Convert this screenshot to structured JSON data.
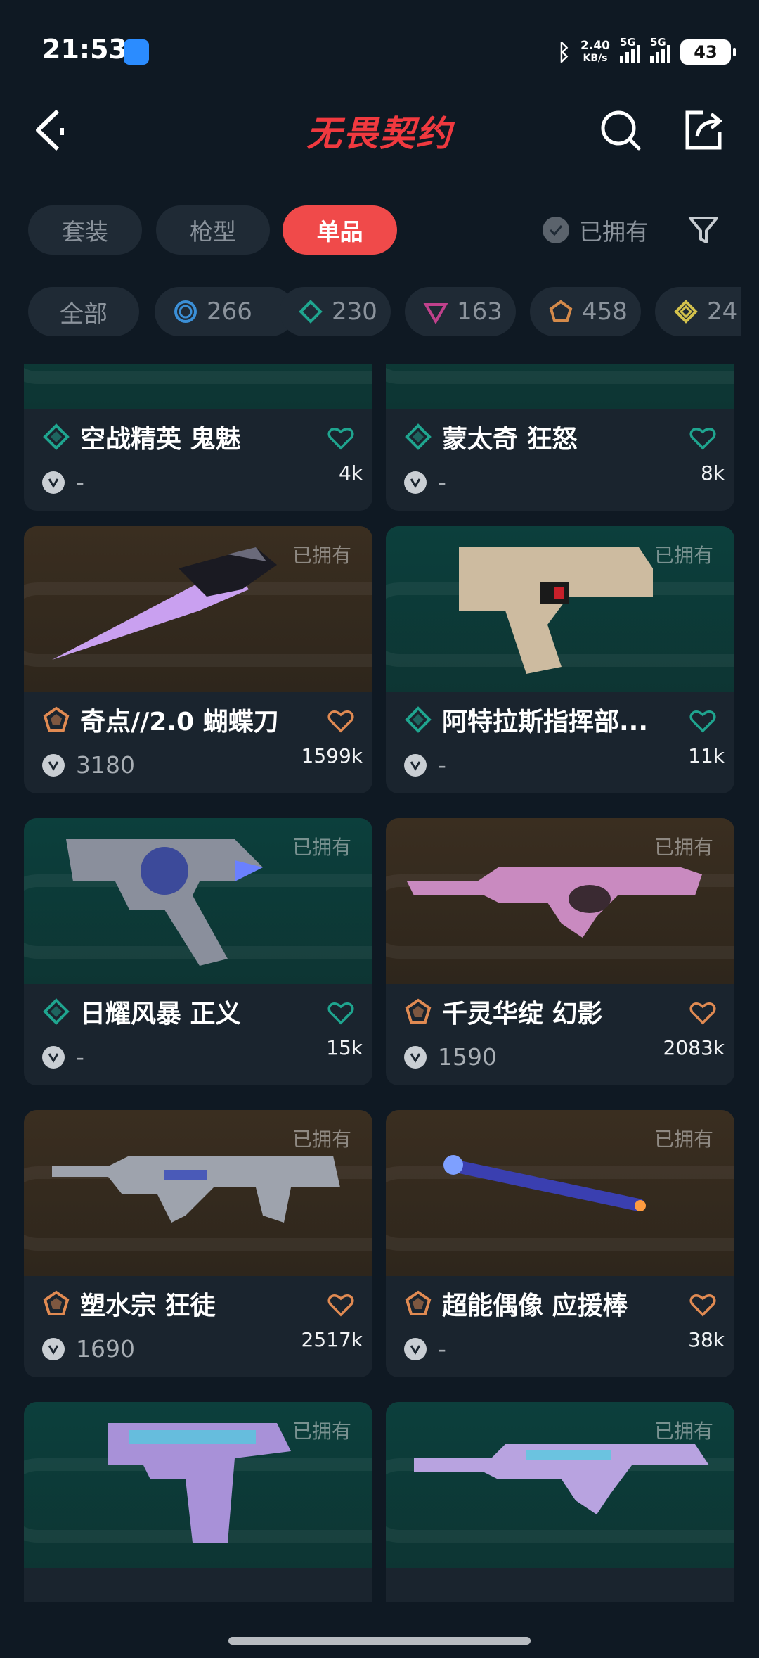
{
  "status_bar": {
    "time": "21:53",
    "net_speed_value": "2.40",
    "net_speed_unit": "KB/s",
    "signal_1_label": "5G",
    "signal_2_label": "5G",
    "battery": "43"
  },
  "header": {
    "title": "无畏契约"
  },
  "tabs": [
    {
      "label": "套装",
      "active": false
    },
    {
      "label": "枪型",
      "active": false
    },
    {
      "label": "单品",
      "active": true
    }
  ],
  "owned_filter": {
    "label": "已拥有"
  },
  "rarity_filters": [
    {
      "label": "全部"
    },
    {
      "label": "266",
      "icon": "select-rarity-icon",
      "color": "#3b8fd6"
    },
    {
      "label": "230",
      "icon": "deluxe-rarity-icon",
      "color": "#1fa58f"
    },
    {
      "label": "163",
      "icon": "premium-rarity-icon",
      "color": "#c0418c"
    },
    {
      "label": "458",
      "icon": "exclusive-rarity-icon",
      "color": "#d48a4a"
    },
    {
      "label": "24",
      "icon": "ultra-rarity-icon",
      "color": "#d3c14c"
    }
  ],
  "colors": {
    "accent": "#f04a4a",
    "deluxe": "#1fa58f",
    "exclusive": "#e08a52"
  },
  "items": [
    {
      "name": "空战精英 鬼魅",
      "price": "-",
      "likes": "4k",
      "rarity": "deluxe",
      "owned": "",
      "art": "teal"
    },
    {
      "name": "蒙太奇 狂怒",
      "price": "-",
      "likes": "8k",
      "rarity": "deluxe",
      "owned": "",
      "art": "teal"
    },
    {
      "name": "奇点//2.0 蝴蝶刀",
      "price": "3180",
      "likes": "1599k",
      "rarity": "exclusive",
      "owned": "已拥有",
      "art": "brown"
    },
    {
      "name": "阿特拉斯指挥部...",
      "price": "-",
      "likes": "11k",
      "rarity": "deluxe",
      "owned": "已拥有",
      "art": "teal"
    },
    {
      "name": "日耀风暴 正义",
      "price": "-",
      "likes": "15k",
      "rarity": "deluxe",
      "owned": "已拥有",
      "art": "teal"
    },
    {
      "name": "千灵华绽 幻影",
      "price": "1590",
      "likes": "2083k",
      "rarity": "exclusive",
      "owned": "已拥有",
      "art": "brown"
    },
    {
      "name": "塑水宗 狂徒",
      "price": "1690",
      "likes": "2517k",
      "rarity": "exclusive",
      "owned": "已拥有",
      "art": "brown"
    },
    {
      "name": "超能偶像 应援棒",
      "price": "-",
      "likes": "38k",
      "rarity": "exclusive",
      "owned": "已拥有",
      "art": "brown"
    },
    {
      "owned": "已拥有",
      "art": "teal"
    },
    {
      "owned": "已拥有",
      "art": "teal"
    }
  ]
}
